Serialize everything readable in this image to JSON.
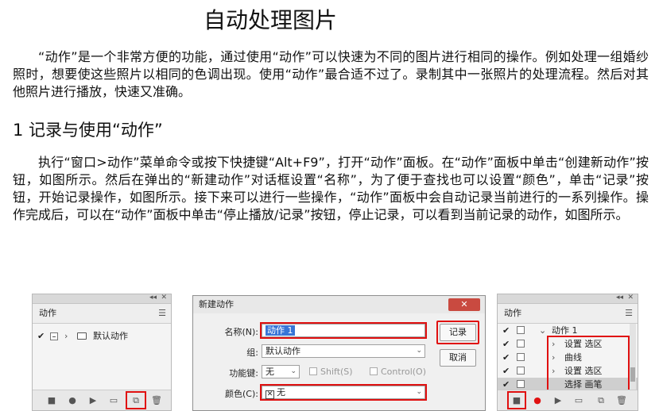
{
  "page": {
    "title": "自动处理图片",
    "intro": "“动作”是一个非常方便的功能，通过使用“动作”可以快速为不同的图片进行相同的操作。例如处理一组婚纱照时，想要使这些照片以相同的色调出现。使用“动作”最合适不过了。录制其中一张照片的处理流程。然后对其他照片进行播放，快速又准确。",
    "section_heading": "1 记录与使用“动作”",
    "body": "执行“窗口>动作”菜单命令或按下快捷键“Alt+F9”，打开“动作”面板。在“动作”面板中单击“创建新动作”按钮，如图所示。然后在弹出的“新建动作”对话框设置“名称”，为了便于查找也可以设置“颜色”，单击“记录”按钮，开始记录操作，如图所示。接下来可以进行一些操作，“动作”面板中会自动记录当前进行的一系列操作。操作完成后，可以在“动作”面板中单击“停止播放/记录”按钮，停止记录，可以看到当前记录的动作，如图所示。"
  },
  "panel_left": {
    "tab": "动作",
    "set_name": "默认动作",
    "icons": [
      "stop-icon",
      "record-icon",
      "play-icon",
      "folder-icon",
      "new-action-icon",
      "trash-icon"
    ]
  },
  "dialog": {
    "title": "新建动作",
    "name_label": "名称(N):",
    "name_value": "动作 1",
    "group_label": "组:",
    "group_value": "默认动作",
    "fkey_label": "功能键:",
    "fkey_value": "无",
    "shift_label": "Shift(S)",
    "control_label": "Control(O)",
    "color_label": "颜色(C):",
    "color_value": "无",
    "record_btn": "记录",
    "cancel_btn": "取消"
  },
  "panel_right": {
    "tab": "动作",
    "action_name": "动作 1",
    "steps": [
      "设置 选区",
      "曲线",
      "设置 选区",
      "选择 画笔"
    ]
  },
  "colors": {
    "highlight_red": "#e01010",
    "selection_blue": "#3875d6"
  }
}
